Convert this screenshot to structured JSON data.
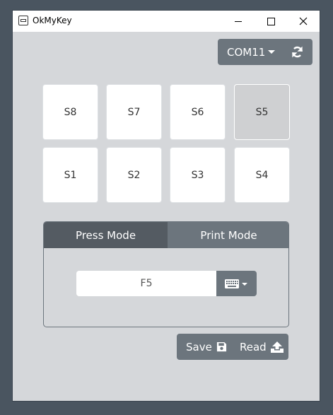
{
  "window": {
    "title": "OkMyKey"
  },
  "port": {
    "label": "COM11"
  },
  "keys": [
    {
      "label": "S8"
    },
    {
      "label": "S7"
    },
    {
      "label": "S6"
    },
    {
      "label": "S5"
    },
    {
      "label": "S1"
    },
    {
      "label": "S2"
    },
    {
      "label": "S3"
    },
    {
      "label": "S4"
    }
  ],
  "selected_key": "S5",
  "modes": {
    "press_label": "Press Mode",
    "print_label": "Print Mode",
    "active": "Press Mode"
  },
  "key_input": {
    "value": "F5"
  },
  "actions": {
    "save_label": "Save",
    "read_label": "Read"
  },
  "icons": {
    "refresh": "refresh-icon",
    "keyboard": "keyboard-icon",
    "save": "floppy-disk-icon",
    "read": "upload-icon"
  },
  "colors": {
    "accent": "#6c757d",
    "active_tab": "#545b62",
    "background": "#d5d7da",
    "selected_key": "#cfd0d2"
  }
}
